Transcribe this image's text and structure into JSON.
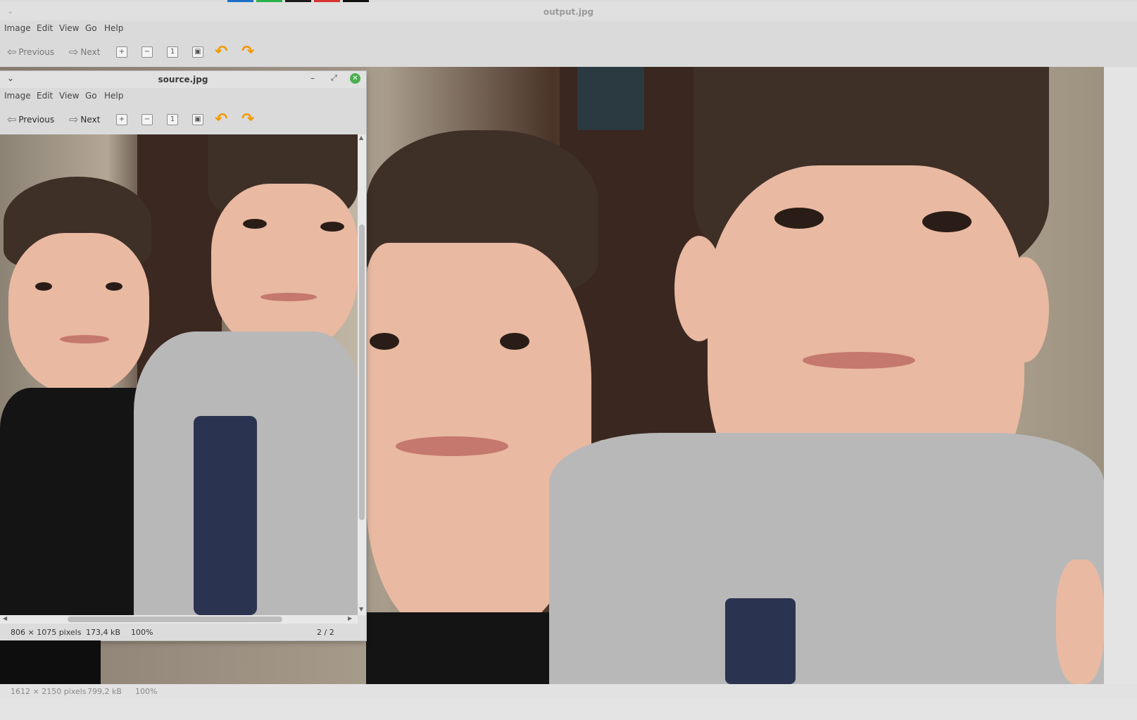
{
  "top_strip": {
    "chips": [
      "#1e6fc8",
      "#2ab24a",
      "#1a1a1a",
      "#d9332f",
      "#111111"
    ]
  },
  "output_window": {
    "title": "output.jpg",
    "menu": [
      "Image",
      "Edit",
      "View",
      "Go",
      "Help"
    ],
    "toolbar": {
      "previous_label": "Previous",
      "next_label": "Next",
      "zoom_in_icon": "zoom-in-icon",
      "zoom_out_icon": "zoom-out-icon",
      "normal_size_icon": "normal-size-icon",
      "best_fit_icon": "best-fit-icon",
      "rotate_left_icon": "rotate-left-icon",
      "rotate_right_icon": "rotate-right-icon"
    },
    "status": {
      "dimensions": "1612 × 2150 pixels",
      "size": "799,2 kB",
      "zoom": "100%"
    }
  },
  "source_window": {
    "title": "source.jpg",
    "menu": [
      "Image",
      "Edit",
      "View",
      "Go",
      "Help"
    ],
    "toolbar": {
      "previous_label": "Previous",
      "next_label": "Next"
    },
    "status": {
      "dimensions": "806 × 1075 pixels",
      "size": "173,4 kB",
      "zoom": "100%",
      "position": "2 / 2"
    }
  },
  "colors": {
    "accent_rotate": "#f29900",
    "close_button": "#4caf50"
  }
}
